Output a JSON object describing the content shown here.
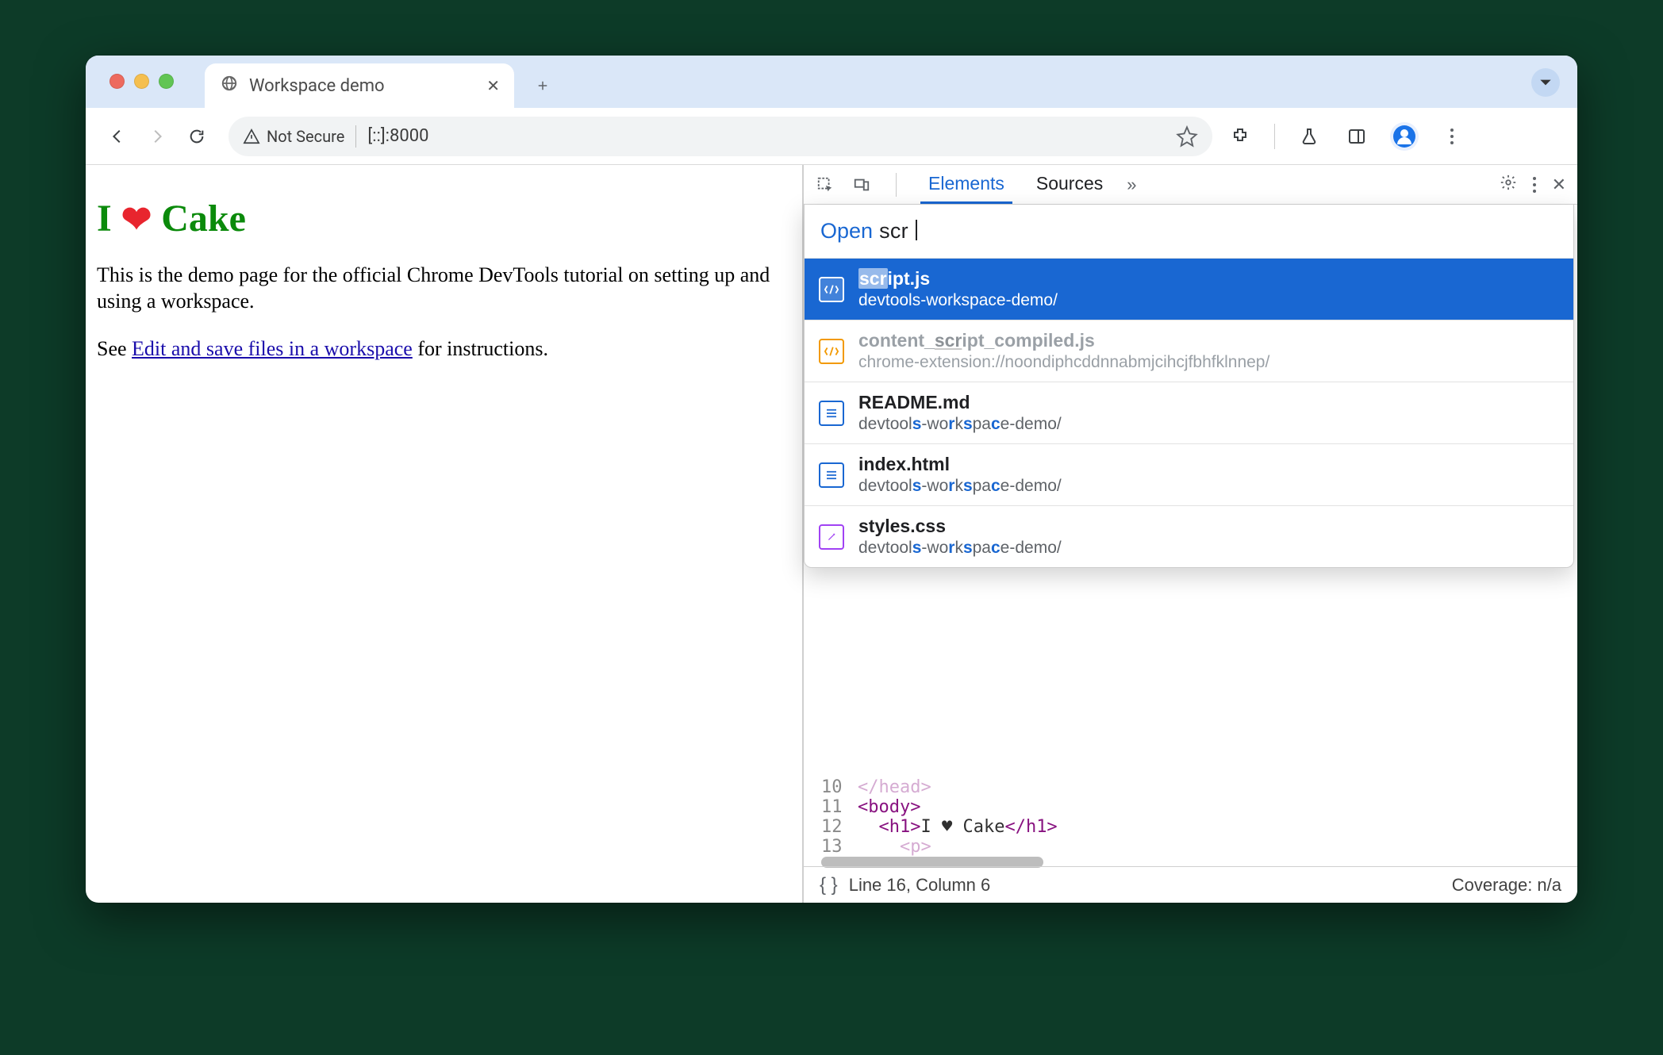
{
  "browser": {
    "tab_title": "Workspace demo",
    "security_label": "Not Secure",
    "url": "[::]:8000"
  },
  "page": {
    "heading_i": "I",
    "heading_cake": "Cake",
    "paragraph": "This is the demo page for the official Chrome DevTools tutorial on setting up and using a workspace.",
    "see_prefix": "See ",
    "link_text": "Edit and save files in a workspace",
    "see_suffix": " for instructions."
  },
  "devtools": {
    "tabs": {
      "elements": "Elements",
      "sources": "Sources"
    },
    "code_lines": [
      {
        "num": "10",
        "text": "</head>",
        "faded": true
      },
      {
        "num": "11",
        "text": "<body>"
      },
      {
        "num": "12",
        "text": "  <h1>I ♥ Cake</h1>"
      },
      {
        "num": "13",
        "text": "    <p>",
        "faded": true
      }
    ],
    "status_left": "Line 16, Column 6",
    "status_right": "Coverage: n/a"
  },
  "quickopen": {
    "open_label": "Open",
    "query": "scr",
    "items": [
      {
        "name": "script.js",
        "path": "devtools-workspace-demo/",
        "kind": "js",
        "sel": true
      },
      {
        "name": "content_script_compiled.js",
        "path": "chrome-extension://noondiphcddnnabmjcihcjfbhfklnnep/",
        "kind": "js-o",
        "dim": true
      },
      {
        "name": "README.md",
        "path": "devtools-workspace-demo/",
        "kind": "doc"
      },
      {
        "name": "index.html",
        "path": "devtools-workspace-demo/",
        "kind": "doc"
      },
      {
        "name": "styles.css",
        "path": "devtools-workspace-demo/",
        "kind": "css"
      }
    ]
  }
}
